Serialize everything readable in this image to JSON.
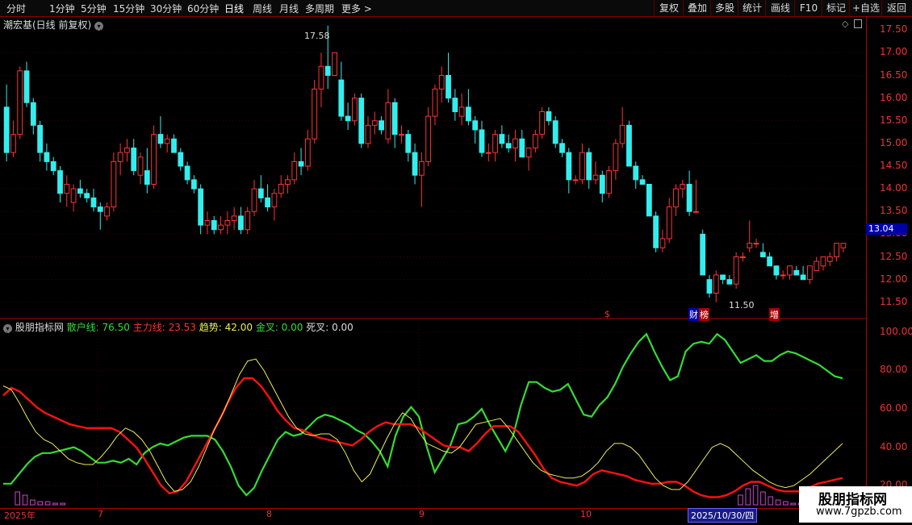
{
  "toolbar": {
    "periods": [
      "分时",
      "1分钟",
      "5分钟",
      "15分钟",
      "30分钟",
      "60分钟",
      "日线",
      "周线",
      "月线",
      "多周期",
      "更多 >"
    ],
    "active": "日线",
    "right_buttons": [
      "复权",
      "叠加",
      "多股",
      "统计",
      "画线",
      "F10",
      "标记",
      "+自选",
      "返回"
    ]
  },
  "main_title": "潮宏基(日线 前复权)",
  "price_axis": [
    "17.50",
    "17.00",
    "16.50",
    "16.00",
    "15.50",
    "15.00",
    "14.50",
    "14.00",
    "13.50",
    "13.00",
    "12.50",
    "12.00",
    "11.50"
  ],
  "current_price": "13.04",
  "high_label": "17.58",
  "low_label": "11.50",
  "event_marks": [
    "$",
    "财",
    "榜",
    "增"
  ],
  "indicator": {
    "name": "股朋指标网",
    "sanhu_label": "散户线: 76.50",
    "zhuli_label": "主力线: 23.53",
    "qushi_label": "趋势: 42.00",
    "jincha_label": "金叉: 0.00",
    "sicha_label": "死叉: 0.00"
  },
  "indicator_axis": [
    "100.00",
    "80.00",
    "60.00",
    "40.00",
    "20.00"
  ],
  "x_axis": [
    "2025年",
    "7",
    "8",
    "9",
    "10"
  ],
  "selected_date": "2025/10/30/四",
  "watermark": {
    "title": "股朋指标网",
    "url": "www.7gpzb.com"
  },
  "colors": {
    "up": "#ff3333",
    "down": "#33eeee",
    "sanhu": "#33dd33",
    "zhuli": "#ff1111",
    "qushi": "#eeee55",
    "bar": "#cc44cc"
  },
  "chart_data": [
    {
      "type": "candlestick",
      "title": "潮宏基(日线 前复权)",
      "ylim": [
        11.3,
        17.7
      ],
      "ohlc": [
        [
          15.8,
          16.3,
          14.6,
          14.8
        ],
        [
          14.8,
          15.5,
          14.7,
          15.2
        ],
        [
          15.2,
          16.7,
          15.1,
          16.6
        ],
        [
          16.6,
          16.8,
          15.8,
          15.9
        ],
        [
          15.9,
          16.0,
          15.2,
          15.4
        ],
        [
          15.4,
          15.5,
          14.6,
          14.8
        ],
        [
          14.8,
          15.0,
          14.4,
          14.6
        ],
        [
          14.6,
          14.7,
          14.3,
          14.4
        ],
        [
          14.4,
          14.5,
          13.7,
          13.9
        ],
        [
          13.9,
          14.3,
          13.6,
          14.1
        ],
        [
          13.7,
          14.1,
          13.5,
          14.0
        ],
        [
          14.0,
          14.2,
          13.8,
          13.9
        ],
        [
          13.9,
          14.0,
          13.7,
          13.8
        ],
        [
          13.8,
          14.0,
          13.5,
          13.6
        ],
        [
          13.6,
          13.7,
          13.1,
          13.5
        ],
        [
          13.4,
          13.7,
          13.3,
          13.6
        ],
        [
          13.6,
          14.8,
          13.5,
          14.6
        ],
        [
          14.6,
          15.0,
          14.3,
          14.8
        ],
        [
          14.8,
          15.1,
          14.6,
          14.9
        ],
        [
          14.9,
          15.1,
          14.3,
          14.4
        ],
        [
          14.3,
          14.8,
          14.1,
          14.7
        ],
        [
          14.4,
          14.9,
          13.9,
          14.1
        ],
        [
          14.1,
          15.4,
          14.0,
          15.2
        ],
        [
          15.2,
          15.6,
          14.9,
          15.0
        ],
        [
          15.0,
          15.2,
          14.8,
          15.1
        ],
        [
          15.1,
          15.2,
          14.8,
          14.8
        ],
        [
          14.8,
          14.9,
          14.4,
          14.5
        ],
        [
          14.5,
          14.6,
          14.1,
          14.2
        ],
        [
          14.2,
          14.3,
          13.9,
          14.0
        ],
        [
          14.0,
          14.1,
          13.0,
          13.2
        ],
        [
          13.2,
          13.5,
          13.0,
          13.3
        ],
        [
          13.3,
          13.4,
          13.0,
          13.1
        ],
        [
          13.1,
          13.4,
          13.0,
          13.2
        ],
        [
          13.2,
          13.5,
          13.0,
          13.3
        ],
        [
          13.3,
          13.6,
          13.1,
          13.4
        ],
        [
          13.4,
          13.6,
          13.0,
          13.1
        ],
        [
          13.1,
          13.6,
          13.0,
          13.5
        ],
        [
          13.5,
          14.2,
          13.4,
          14.0
        ],
        [
          14.0,
          14.3,
          13.7,
          13.8
        ],
        [
          13.8,
          14.1,
          13.5,
          13.6
        ],
        [
          13.6,
          14.0,
          13.3,
          13.9
        ],
        [
          13.9,
          14.3,
          13.8,
          14.1
        ],
        [
          14.1,
          14.3,
          13.9,
          14.2
        ],
        [
          14.2,
          14.8,
          14.1,
          14.6
        ],
        [
          14.6,
          14.9,
          14.3,
          14.5
        ],
        [
          14.5,
          15.3,
          14.4,
          15.1
        ],
        [
          15.1,
          16.4,
          15.0,
          16.2
        ],
        [
          16.2,
          17.0,
          15.8,
          16.7
        ],
        [
          16.7,
          17.6,
          16.2,
          16.5
        ],
        [
          16.5,
          17.0,
          16.5,
          17.0
        ],
        [
          16.4,
          16.8,
          15.5,
          15.6
        ],
        [
          15.6,
          15.9,
          15.3,
          15.5
        ],
        [
          15.5,
          16.1,
          15.4,
          16.0
        ],
        [
          16.0,
          16.1,
          14.9,
          15.0
        ],
        [
          15.0,
          15.6,
          14.9,
          15.4
        ],
        [
          15.4,
          15.7,
          15.2,
          15.5
        ],
        [
          15.5,
          15.6,
          15.2,
          15.3
        ],
        [
          15.1,
          16.2,
          15.0,
          15.9
        ],
        [
          15.9,
          16.0,
          14.9,
          15.2
        ],
        [
          15.2,
          15.4,
          15.0,
          15.2
        ],
        [
          15.2,
          15.3,
          14.6,
          14.8
        ],
        [
          14.8,
          15.0,
          14.1,
          14.3
        ],
        [
          14.3,
          14.8,
          13.6,
          14.6
        ],
        [
          14.6,
          15.8,
          14.5,
          15.6
        ],
        [
          15.6,
          16.3,
          15.4,
          16.2
        ],
        [
          16.2,
          16.7,
          15.9,
          16.5
        ],
        [
          16.5,
          17.0,
          15.9,
          16.0
        ],
        [
          16.0,
          16.2,
          15.5,
          15.7
        ],
        [
          15.6,
          16.1,
          15.4,
          15.8
        ],
        [
          15.8,
          16.2,
          15.4,
          15.5
        ],
        [
          15.5,
          15.6,
          15.0,
          15.3
        ],
        [
          15.3,
          15.5,
          14.7,
          14.8
        ],
        [
          14.8,
          15.0,
          14.6,
          14.8
        ],
        [
          14.8,
          15.3,
          14.6,
          15.2
        ],
        [
          15.2,
          15.4,
          14.9,
          15.0
        ],
        [
          15.0,
          15.2,
          14.8,
          14.9
        ],
        [
          14.9,
          15.3,
          14.6,
          15.1
        ],
        [
          15.1,
          15.3,
          14.7,
          14.7
        ],
        [
          14.7,
          14.9,
          14.4,
          14.9
        ],
        [
          14.9,
          15.3,
          14.8,
          15.2
        ],
        [
          15.2,
          15.8,
          15.1,
          15.7
        ],
        [
          15.7,
          15.8,
          15.4,
          15.5
        ],
        [
          15.5,
          15.6,
          14.9,
          15.0
        ],
        [
          15.0,
          15.1,
          14.7,
          14.8
        ],
        [
          14.8,
          14.9,
          13.9,
          14.2
        ],
        [
          14.2,
          14.3,
          14.1,
          14.2
        ],
        [
          14.2,
          15.0,
          14.1,
          14.8
        ],
        [
          14.8,
          14.9,
          14.0,
          14.2
        ],
        [
          14.2,
          14.6,
          14.1,
          14.3
        ],
        [
          14.3,
          14.4,
          13.7,
          13.9
        ],
        [
          13.9,
          14.5,
          13.8,
          14.4
        ],
        [
          14.4,
          15.1,
          14.2,
          15.0
        ],
        [
          15.0,
          15.8,
          14.9,
          15.4
        ],
        [
          15.4,
          15.5,
          14.5,
          14.5
        ],
        [
          14.5,
          14.6,
          14.0,
          14.2
        ],
        [
          14.2,
          14.3,
          14.1,
          14.1
        ],
        [
          14.1,
          14.1,
          13.5,
          13.4
        ],
        [
          13.4,
          13.5,
          12.6,
          12.7
        ],
        [
          12.7,
          13.1,
          12.6,
          12.9
        ],
        [
          12.9,
          13.8,
          12.8,
          13.6
        ],
        [
          13.6,
          14.1,
          13.4,
          14.0
        ],
        [
          14.0,
          14.2,
          13.8,
          14.1
        ],
        [
          14.1,
          14.4,
          13.4,
          13.5
        ],
        [
          13.5,
          14.2,
          13.5,
          13.5
        ],
        [
          13.0,
          13.1,
          12.2,
          12.1
        ],
        [
          12.0,
          12.1,
          11.6,
          11.7
        ],
        [
          11.7,
          12.2,
          11.5,
          12.1
        ],
        [
          12.1,
          12.1,
          11.9,
          12.0
        ],
        [
          12.0,
          12.1,
          11.9,
          11.9
        ],
        [
          11.9,
          12.6,
          11.8,
          12.5
        ],
        [
          12.5,
          12.6,
          12.4,
          12.5
        ],
        [
          12.7,
          13.3,
          12.6,
          12.8
        ],
        [
          12.8,
          12.9,
          12.7,
          12.8
        ],
        [
          12.6,
          12.8,
          12.5,
          12.5
        ],
        [
          12.5,
          12.6,
          12.3,
          12.3
        ],
        [
          12.3,
          12.3,
          12.0,
          12.1
        ],
        [
          12.1,
          12.2,
          12.0,
          12.1
        ],
        [
          12.1,
          12.3,
          12.0,
          12.3
        ],
        [
          12.2,
          12.3,
          12.1,
          12.1
        ],
        [
          12.1,
          12.3,
          12.0,
          12.0
        ],
        [
          12.0,
          12.3,
          11.9,
          12.3
        ],
        [
          12.2,
          12.5,
          12.2,
          12.4
        ],
        [
          12.3,
          12.5,
          12.2,
          12.5
        ],
        [
          12.4,
          12.6,
          12.3,
          12.5
        ],
        [
          12.5,
          12.8,
          12.4,
          12.8
        ],
        [
          12.7,
          12.8,
          12.6,
          12.8
        ]
      ]
    },
    {
      "type": "line",
      "title": "股朋指标网",
      "ylim": [
        10,
        105
      ],
      "series": [
        {
          "name": "散户线",
          "values": [
            21,
            21,
            26,
            31,
            35,
            37,
            37,
            38,
            39,
            40,
            38,
            35,
            32,
            32,
            33,
            32,
            34,
            31,
            37,
            40,
            42,
            41,
            43,
            45,
            46,
            46,
            46,
            44,
            38,
            30,
            20,
            15,
            19,
            28,
            36,
            44,
            48,
            46,
            47,
            51,
            55,
            57,
            56,
            54,
            52,
            49,
            47,
            43,
            38,
            30,
            46,
            56,
            61,
            56,
            40,
            27,
            34,
            41,
            52,
            53,
            56,
            60,
            52,
            45,
            38,
            46,
            62,
            74,
            74,
            71,
            69,
            70,
            73,
            65,
            57,
            56,
            62,
            66,
            73,
            82,
            89,
            95,
            99,
            90,
            82,
            75,
            77,
            90,
            94,
            95,
            94,
            99,
            96,
            90,
            84,
            86,
            88,
            85,
            85,
            88,
            90,
            89,
            87,
            85,
            83,
            80,
            77,
            76
          ]
        },
        {
          "name": "主力线",
          "values": [
            67,
            71,
            69,
            65,
            61,
            58,
            56,
            54,
            52,
            51,
            50,
            50,
            50,
            50,
            48,
            44,
            40,
            34,
            27,
            20,
            16,
            17,
            22,
            30,
            38,
            46,
            54,
            63,
            71,
            76,
            76,
            72,
            66,
            59,
            54,
            50,
            49,
            47,
            45,
            44,
            43,
            42,
            41,
            44,
            48,
            51,
            53,
            52,
            52,
            52,
            50,
            47,
            44,
            41,
            40,
            40,
            38,
            42,
            47,
            51,
            51,
            51,
            48,
            42,
            36,
            29,
            24,
            22,
            21,
            20,
            22,
            26,
            28,
            27,
            26,
            25,
            23,
            22,
            21,
            21,
            22,
            22,
            20,
            17,
            15,
            14,
            14,
            15,
            17,
            20,
            22,
            22,
            20,
            18,
            17,
            17,
            17,
            19,
            21,
            22,
            23,
            24
          ]
        },
        {
          "name": "趋势",
          "values": [
            72,
            70,
            63,
            55,
            48,
            44,
            42,
            38,
            34,
            32,
            31,
            31,
            35,
            40,
            46,
            50,
            48,
            44,
            38,
            30,
            22,
            17,
            18,
            22,
            30,
            40,
            50,
            58,
            68,
            78,
            85,
            86,
            80,
            72,
            64,
            56,
            50,
            47,
            46,
            47,
            47,
            44,
            37,
            28,
            22,
            26,
            35,
            44,
            52,
            58,
            55,
            48,
            42,
            40,
            38,
            37,
            40,
            46,
            52,
            53,
            54,
            55,
            50,
            44,
            38,
            32,
            28,
            26,
            25,
            24,
            24,
            25,
            28,
            32,
            38,
            42,
            42,
            40,
            36,
            30,
            24,
            20,
            18,
            18,
            22,
            28,
            34,
            40,
            42,
            40,
            36,
            32,
            28,
            25,
            22,
            20,
            19,
            20,
            23,
            26,
            30,
            34,
            38,
            42
          ]
        },
        {
          "name": "柱",
          "values": [
            8,
            6,
            3,
            2,
            2,
            1,
            1,
            0,
            0,
            0,
            0,
            0,
            0,
            0,
            0,
            0,
            0,
            0,
            0,
            0,
            0,
            0,
            0,
            0,
            0,
            0,
            0,
            0,
            0,
            0,
            0,
            0,
            0,
            0,
            0,
            0,
            0,
            0,
            0,
            0,
            0,
            0,
            0,
            0,
            0,
            0,
            0,
            0,
            0,
            0,
            0,
            0,
            0,
            0,
            0,
            0,
            0,
            0,
            0,
            0,
            0,
            0,
            0,
            0,
            0,
            0,
            0,
            0,
            0,
            0,
            0,
            0,
            0,
            0,
            0,
            0,
            0,
            0,
            0,
            0,
            0,
            0,
            0,
            0,
            0,
            0,
            0,
            0,
            0,
            0,
            0,
            0,
            0,
            0,
            0,
            0,
            6,
            10,
            12,
            8,
            5,
            3,
            2,
            1,
            1,
            0,
            7,
            9,
            5,
            2,
            1,
            0
          ]
        }
      ]
    }
  ]
}
